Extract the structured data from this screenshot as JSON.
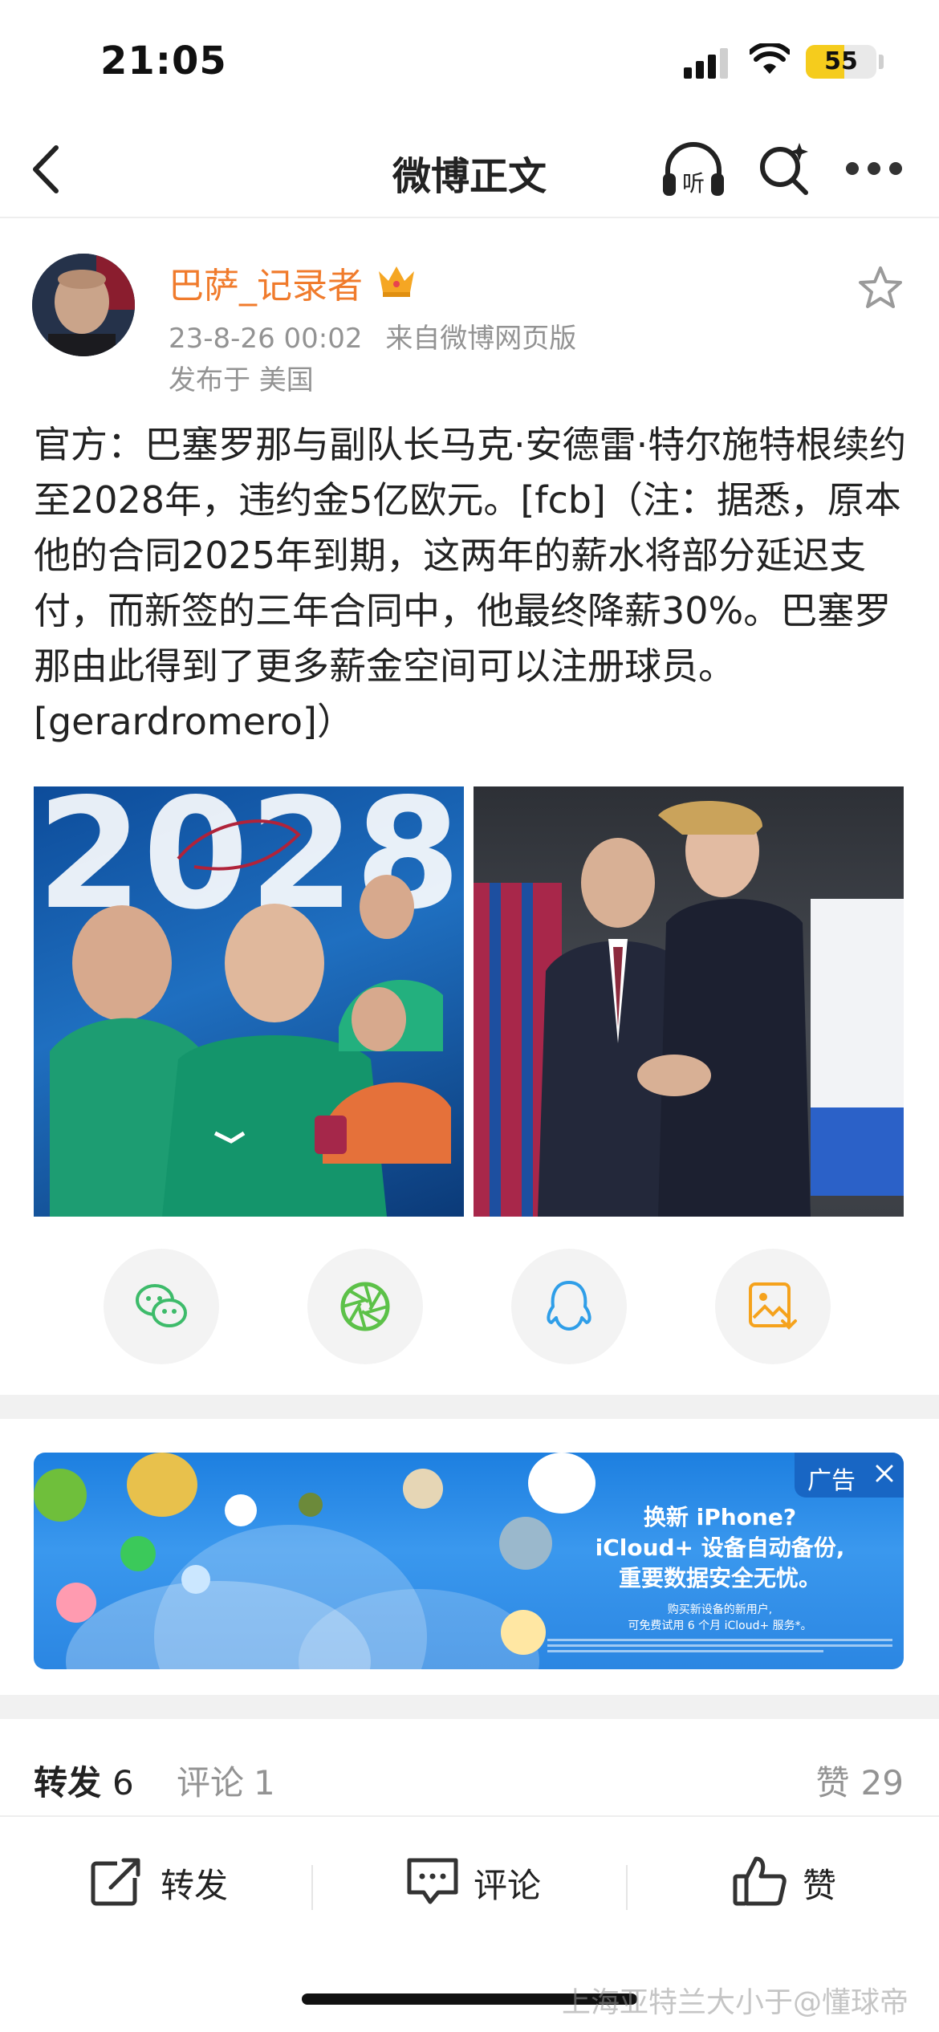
{
  "status_bar": {
    "time": "21:05",
    "battery": "55",
    "battery_level": 0.55,
    "icons": [
      "signal-icon",
      "wifi-icon",
      "battery-icon"
    ]
  },
  "nav": {
    "title": "微博正文",
    "icons": [
      "back-arrow-icon",
      "listen-headphones-icon",
      "search-icon",
      "more-dots-icon"
    ]
  },
  "post": {
    "author": "巴萨_记录者",
    "author_color": "#f07b2c",
    "author_badge_icon": "crown-icon",
    "date": "23-8-26 00:02",
    "source": "来自微博网页版",
    "location": "发布于 美国",
    "text": "官方：巴塞罗那与副队长马克·安德雷·特尔施特根续约至2028年，违约金5亿欧元。[fcb]（注：据悉，原本他的合同2025年到期，这两年的薪水将部分延迟支付，而新签的三年合同中，他最终降薪30%。巴塞罗那由此得到了更多薪金空间可以注册球员。[gerardromero]）",
    "image1_text": "2028",
    "images": [
      "poster-image",
      "photo-image"
    ]
  },
  "share": {
    "icons": [
      "wechat-icon",
      "moments-icon",
      "qq-icon",
      "save-image-icon"
    ]
  },
  "ad": {
    "badge": "广告",
    "line1": "换新 iPhone?",
    "line2": "iCloud+ 设备自动备份,",
    "line3": "重要数据安全无忧。",
    "small1": "购买新设备的新用户,",
    "small2": "可免费试用 6 个月 iCloud+ 服务*。"
  },
  "counts": {
    "repost_label": "转发",
    "repost_count": "6",
    "comment_label": "评论",
    "comment_count": "1",
    "like_label": "赞",
    "like_count": "29"
  },
  "actions": {
    "repost": "转发",
    "comment": "评论",
    "like": "赞"
  },
  "watermark": "上海亚特兰大小于@懂球帝"
}
